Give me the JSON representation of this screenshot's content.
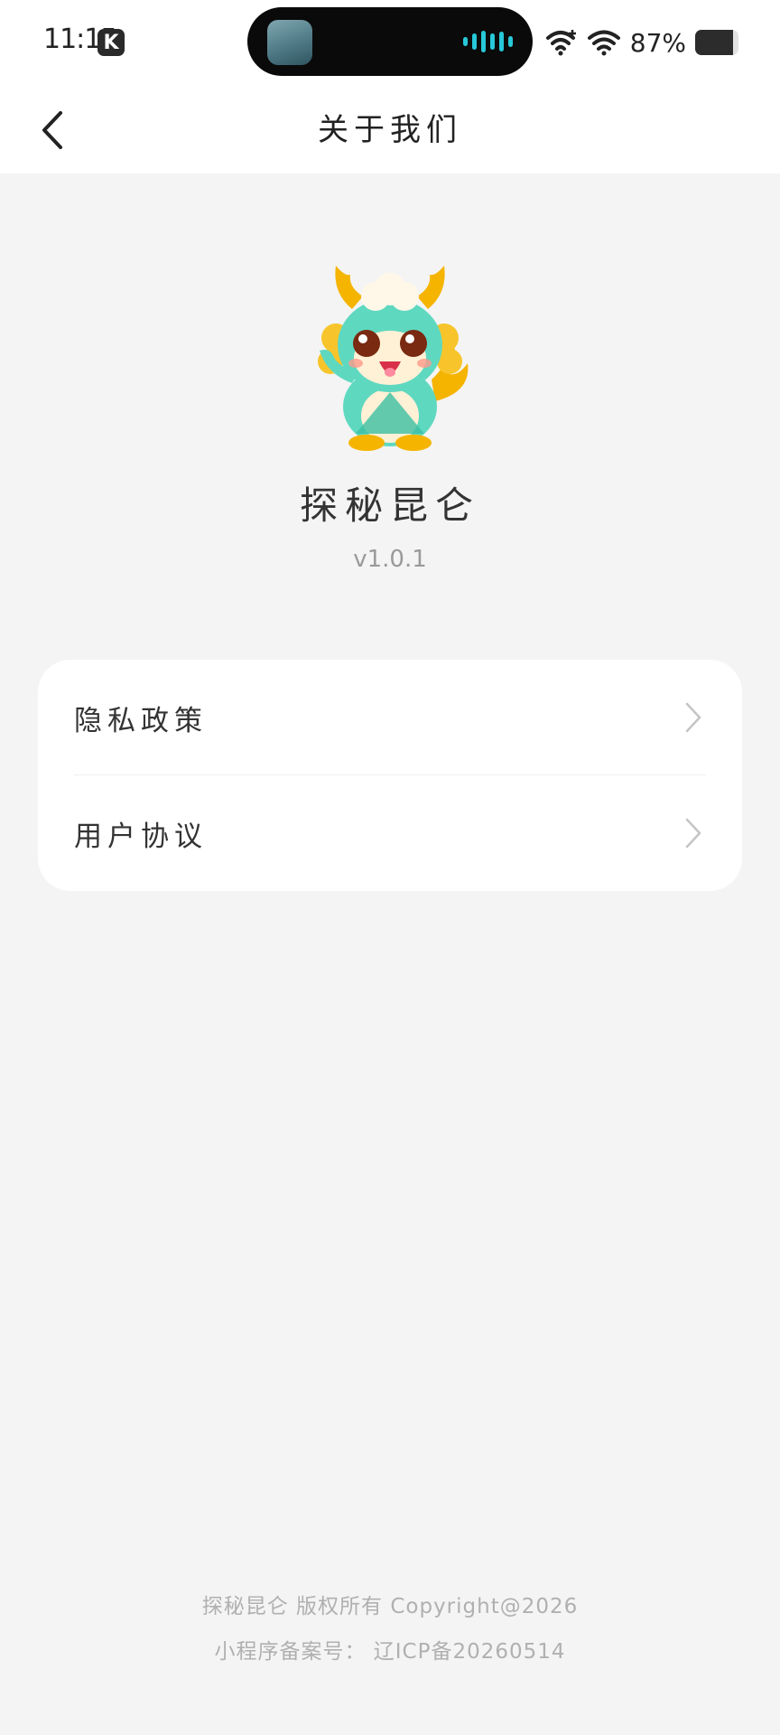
{
  "status_bar": {
    "time": "11:15",
    "app_badge": "K",
    "battery_percent": "87%",
    "battery_level": 0.87
  },
  "nav": {
    "title": "关于我们"
  },
  "app": {
    "name": "探秘昆仑",
    "version": "v1.0.1"
  },
  "menu": {
    "items": [
      {
        "label": "隐私政策"
      },
      {
        "label": "用户协议"
      }
    ]
  },
  "footer": {
    "copyright": "探秘昆仑 版权所有 Copyright@2026",
    "icp": "小程序备案号： 辽ICP备20260514"
  },
  "colors": {
    "background": "#f4f4f4",
    "card": "#ffffff",
    "island_wave": "#27c8d8",
    "dragon_body": "#5fd8c0",
    "dragon_horns": "#f5b400"
  }
}
